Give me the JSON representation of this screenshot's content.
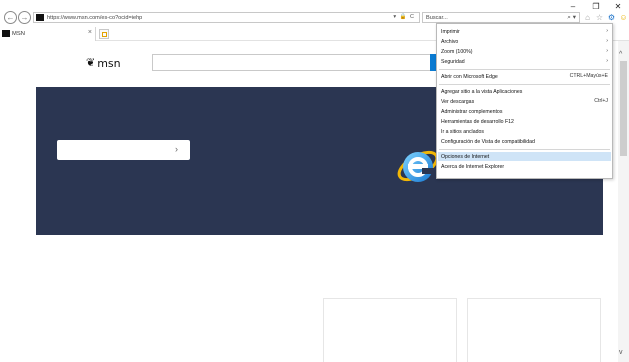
{
  "browser": {
    "url": "https://www.msn.com/es-co?ocid=iehp",
    "address_tools": "▾ 🔒 C",
    "search_placeholder": "Buscar...",
    "window_controls": {
      "minimize": "–",
      "maximize": "❐",
      "close": "✕"
    },
    "back_symbol": "←",
    "forward_symbol": "→",
    "search_icon_symbol": "⌕ ▾",
    "toolbar_icons": [
      "home-icon",
      "star-icon",
      "gear-icon",
      "smiley-icon"
    ],
    "accent_color": "#1e73c9"
  },
  "tab": {
    "title": "MSN",
    "close_symbol": "×"
  },
  "page": {
    "logo_text": "msn",
    "hero_arrow": "›",
    "hero_color": "#2b3652",
    "search_button_color": "#0a7ad1"
  },
  "scrollbar": {
    "up": "^",
    "down": "v"
  },
  "menu": {
    "items": [
      {
        "label": "Imprimir",
        "right": "›"
      },
      {
        "label": "Archivo",
        "right": "›"
      },
      {
        "label": "Zoom (100%)",
        "right": "›"
      },
      {
        "label": "Seguridad",
        "right": "›"
      },
      {
        "label": "Abrir con Microsoft Edge",
        "right": "CTRL+Mayús+E"
      },
      {
        "label": "Agregar sitio a la vista Aplicaciones",
        "right": ""
      },
      {
        "label": "Ver descargas",
        "right": "Ctrl+J"
      },
      {
        "label": "Administrar complementos",
        "right": ""
      },
      {
        "label": "Herramientas de desarrollo F12",
        "right": ""
      },
      {
        "label": "Ir a sitios anclados",
        "right": ""
      },
      {
        "label": "Configuración de Vista de compatibilidad",
        "right": ""
      },
      {
        "label": "Opciones de Internet",
        "right": ""
      },
      {
        "label": "Acerca de Internet Explorer",
        "right": ""
      }
    ],
    "highlighted_label": "Opciones de Internet",
    "highlight_color": "#cfe4f7"
  }
}
